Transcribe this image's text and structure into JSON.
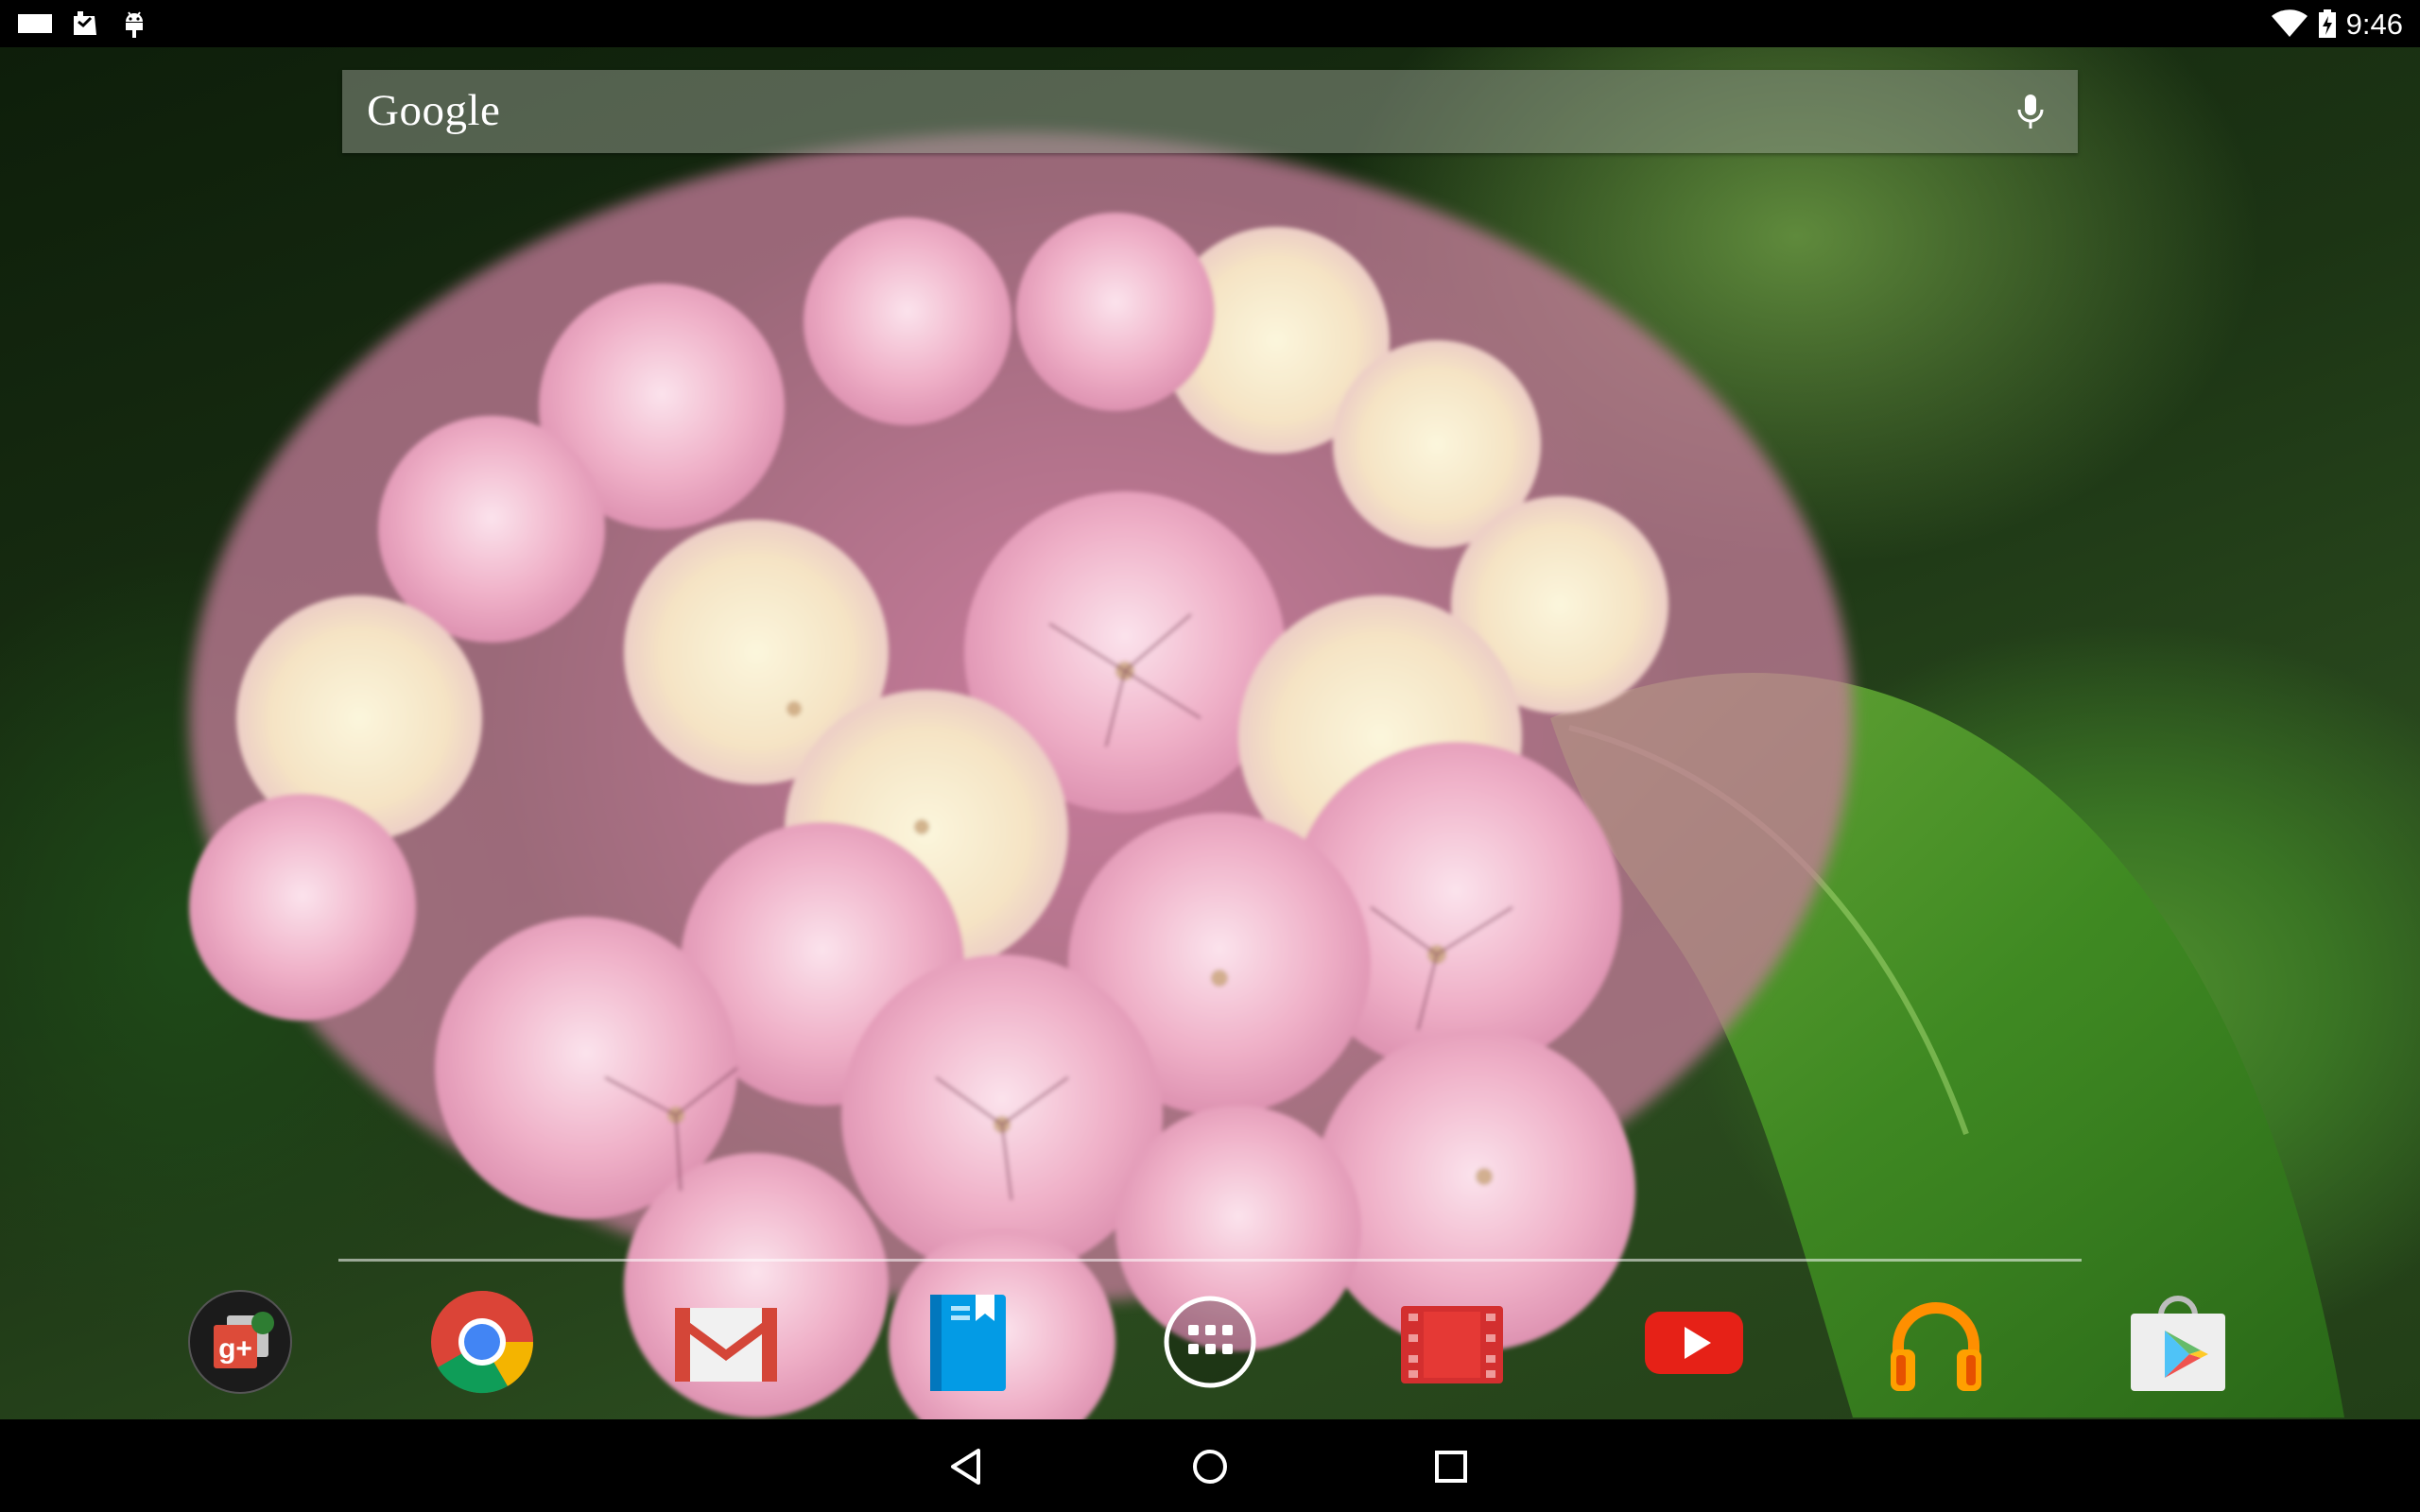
{
  "status_bar": {
    "time": "9:46",
    "left_icons": [
      "screenshot-icon",
      "sd-card-icon",
      "android-debug-icon"
    ],
    "right_icons": [
      "wifi-icon",
      "battery-charging-icon"
    ]
  },
  "search": {
    "logo_text": "Google",
    "mic_icon": "microphone-icon"
  },
  "dock": {
    "apps": [
      {
        "icon": "google-plus-photos-icon",
        "accent": "#dd4b39"
      },
      {
        "icon": "chrome-icon",
        "accent": "#4285f4"
      },
      {
        "icon": "gmail-icon",
        "accent": "#d44638"
      },
      {
        "icon": "play-books-icon",
        "accent": "#039be5"
      },
      {
        "icon": "all-apps-icon",
        "accent": "#ffffff"
      },
      {
        "icon": "play-movies-icon",
        "accent": "#d32f2f"
      },
      {
        "icon": "youtube-icon",
        "accent": "#e62117"
      },
      {
        "icon": "play-music-icon",
        "accent": "#ff8f00"
      },
      {
        "icon": "play-store-icon",
        "accent": "#e0e0e0"
      }
    ]
  },
  "nav_bar": {
    "buttons": [
      "back-icon",
      "home-icon",
      "recents-icon"
    ]
  }
}
